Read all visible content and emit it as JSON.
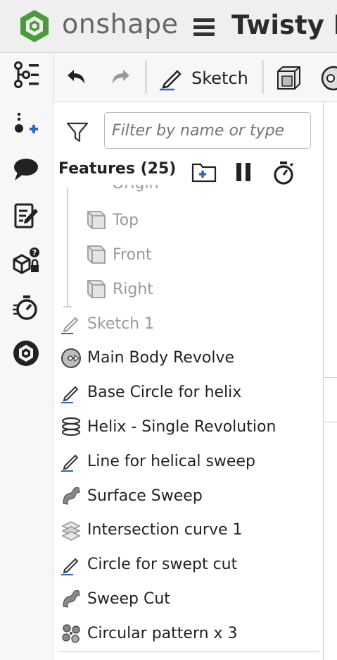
{
  "app": {
    "brand": "onshape",
    "document_title": "Twisty F"
  },
  "toolbar": {
    "sketch_label": "Sketch"
  },
  "left_rail": {
    "icons": [
      "feature-list-icon",
      "insert-part-icon",
      "comments-icon",
      "notes-icon",
      "part-properties-icon",
      "performance-timer-icon",
      "onshape-app-icon"
    ]
  },
  "feature_panel": {
    "filter_placeholder": "Filter by name or type",
    "header": "Features (25)",
    "partial_item": "Origin",
    "planes": [
      {
        "label": "Top"
      },
      {
        "label": "Front"
      },
      {
        "label": "Right"
      }
    ],
    "features": [
      {
        "label": "Sketch 1",
        "icon": "sketch-icon",
        "dim": true
      },
      {
        "label": "Main Body Revolve",
        "icon": "revolve-icon",
        "dim": false
      },
      {
        "label": "Base Circle for helix",
        "icon": "sketch-icon",
        "dim": false
      },
      {
        "label": "Helix - Single Revolution",
        "icon": "helix-icon",
        "dim": false
      },
      {
        "label": "Line for helical sweep",
        "icon": "sketch-icon",
        "dim": false
      },
      {
        "label": "Surface Sweep",
        "icon": "sweep-icon",
        "dim": false
      },
      {
        "label": "Intersection curve 1",
        "icon": "intersection-curve-icon",
        "dim": false
      },
      {
        "label": "Circle for swept cut",
        "icon": "sketch-icon",
        "dim": false
      },
      {
        "label": "Sweep Cut",
        "icon": "sweep-icon",
        "dim": false
      },
      {
        "label": "Circular pattern x 3",
        "icon": "circular-pattern-icon",
        "dim": false
      }
    ]
  },
  "colors": {
    "brand_green": "#4a9b3c",
    "accent_blue": "#2a64c5",
    "dim_text": "#9a9a9a"
  }
}
